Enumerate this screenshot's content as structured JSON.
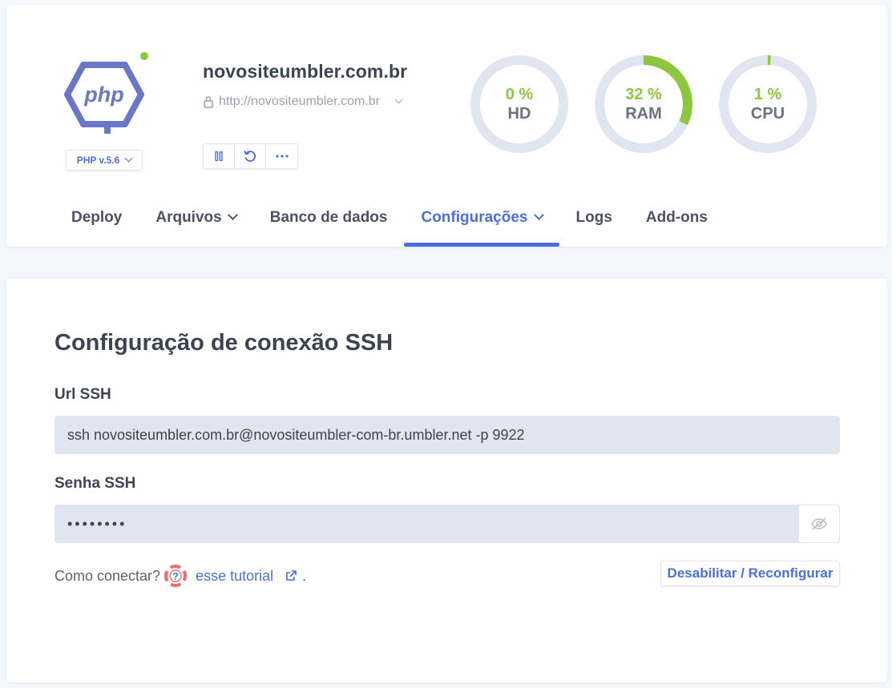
{
  "header": {
    "logo_text": "php",
    "php_version": "PHP v.5.6",
    "site_name": "novositeumbler.com.br",
    "site_url": "http://novositeumbler.com.br",
    "status_color": "#8dc63f",
    "actions": [
      {
        "name": "pause",
        "icon": "pause-icon"
      },
      {
        "name": "restart",
        "icon": "restart-icon"
      },
      {
        "name": "more",
        "icon": "more-icon"
      }
    ]
  },
  "gauges": [
    {
      "label": "HD",
      "value_text": "0 %",
      "percent": 0
    },
    {
      "label": "RAM",
      "value_text": "32 %",
      "percent": 32
    },
    {
      "label": "CPU",
      "value_text": "1 %",
      "percent": 1
    }
  ],
  "gauge_colors": {
    "track": "#dfe5f1",
    "fill": "#8dc63f"
  },
  "tabs": [
    {
      "label": "Deploy",
      "has_dropdown": false,
      "active": false
    },
    {
      "label": "Arquivos",
      "has_dropdown": true,
      "active": false
    },
    {
      "label": "Banco de dados",
      "has_dropdown": false,
      "active": false
    },
    {
      "label": "Configurações",
      "has_dropdown": true,
      "active": true
    },
    {
      "label": "Logs",
      "has_dropdown": false,
      "active": false
    },
    {
      "label": "Add-ons",
      "has_dropdown": false,
      "active": false
    }
  ],
  "ssh": {
    "title": "Configuração de conexão SSH",
    "url_label": "Url SSH",
    "url_value": "ssh novositeumbler.com.br@novositeumbler-com-br.umbler.net -p 9922",
    "password_label": "Senha SSH",
    "password_masked": "••••••••",
    "help_text": "Como conectar?",
    "tutorial_link": "esse tutorial",
    "help_end": ".",
    "disable_button": "Desabilitar / Reconfigurar"
  },
  "colors": {
    "accent": "#4a6fdc",
    "success": "#8dc63f",
    "php_logo": "#6a77c7"
  }
}
